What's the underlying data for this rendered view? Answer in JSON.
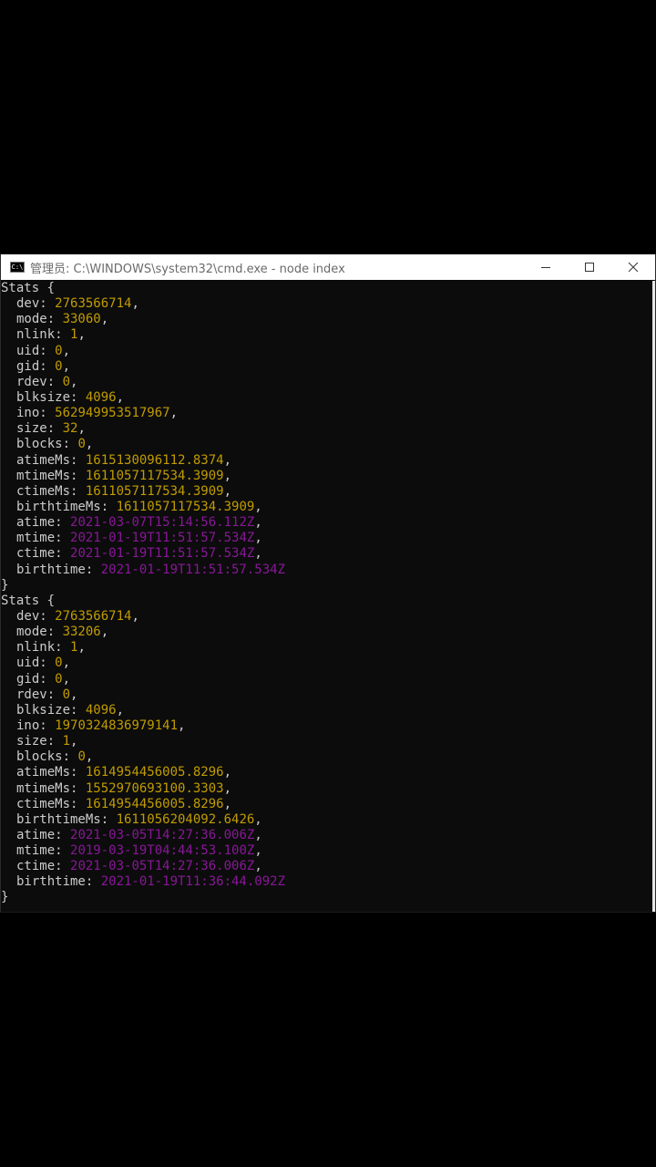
{
  "window": {
    "title": "管理员: C:\\WINDOWS\\system32\\cmd.exe - node  index",
    "icon": "cmd-icon",
    "controls": [
      "minimize-icon",
      "maximize-icon",
      "close-icon"
    ]
  },
  "colors": {
    "number": "#c19c00",
    "date": "#881798",
    "text": "#cccccc",
    "background": "#0c0c0c"
  },
  "blocks": [
    {
      "header": "Stats {",
      "fields": [
        {
          "key": "dev",
          "value": "2763566714",
          "type": "num"
        },
        {
          "key": "mode",
          "value": "33060",
          "type": "num"
        },
        {
          "key": "nlink",
          "value": "1",
          "type": "num"
        },
        {
          "key": "uid",
          "value": "0",
          "type": "num"
        },
        {
          "key": "gid",
          "value": "0",
          "type": "num"
        },
        {
          "key": "rdev",
          "value": "0",
          "type": "num"
        },
        {
          "key": "blksize",
          "value": "4096",
          "type": "num"
        },
        {
          "key": "ino",
          "value": "562949953517967",
          "type": "num"
        },
        {
          "key": "size",
          "value": "32",
          "type": "num"
        },
        {
          "key": "blocks",
          "value": "0",
          "type": "num"
        },
        {
          "key": "atimeMs",
          "value": "1615130096112.8374",
          "type": "num"
        },
        {
          "key": "mtimeMs",
          "value": "1611057117534.3909",
          "type": "num"
        },
        {
          "key": "ctimeMs",
          "value": "1611057117534.3909",
          "type": "num"
        },
        {
          "key": "birthtimeMs",
          "value": "1611057117534.3909",
          "type": "num"
        },
        {
          "key": "atime",
          "value": "2021-03-07T15:14:56.112Z",
          "type": "date"
        },
        {
          "key": "mtime",
          "value": "2021-01-19T11:51:57.534Z",
          "type": "date"
        },
        {
          "key": "ctime",
          "value": "2021-01-19T11:51:57.534Z",
          "type": "date"
        },
        {
          "key": "birthtime",
          "value": "2021-01-19T11:51:57.534Z",
          "type": "date",
          "last": true
        }
      ],
      "footer": "}"
    },
    {
      "header": "Stats {",
      "fields": [
        {
          "key": "dev",
          "value": "2763566714",
          "type": "num"
        },
        {
          "key": "mode",
          "value": "33206",
          "type": "num"
        },
        {
          "key": "nlink",
          "value": "1",
          "type": "num"
        },
        {
          "key": "uid",
          "value": "0",
          "type": "num"
        },
        {
          "key": "gid",
          "value": "0",
          "type": "num"
        },
        {
          "key": "rdev",
          "value": "0",
          "type": "num"
        },
        {
          "key": "blksize",
          "value": "4096",
          "type": "num"
        },
        {
          "key": "ino",
          "value": "1970324836979141",
          "type": "num"
        },
        {
          "key": "size",
          "value": "1",
          "type": "num"
        },
        {
          "key": "blocks",
          "value": "0",
          "type": "num"
        },
        {
          "key": "atimeMs",
          "value": "1614954456005.8296",
          "type": "num"
        },
        {
          "key": "mtimeMs",
          "value": "1552970693100.3303",
          "type": "num"
        },
        {
          "key": "ctimeMs",
          "value": "1614954456005.8296",
          "type": "num"
        },
        {
          "key": "birthtimeMs",
          "value": "1611056204092.6426",
          "type": "num"
        },
        {
          "key": "atime",
          "value": "2021-03-05T14:27:36.006Z",
          "type": "date"
        },
        {
          "key": "mtime",
          "value": "2019-03-19T04:44:53.100Z",
          "type": "date"
        },
        {
          "key": "ctime",
          "value": "2021-03-05T14:27:36.006Z",
          "type": "date"
        },
        {
          "key": "birthtime",
          "value": "2021-01-19T11:36:44.092Z",
          "type": "date",
          "last": true
        }
      ],
      "footer": "}"
    }
  ]
}
